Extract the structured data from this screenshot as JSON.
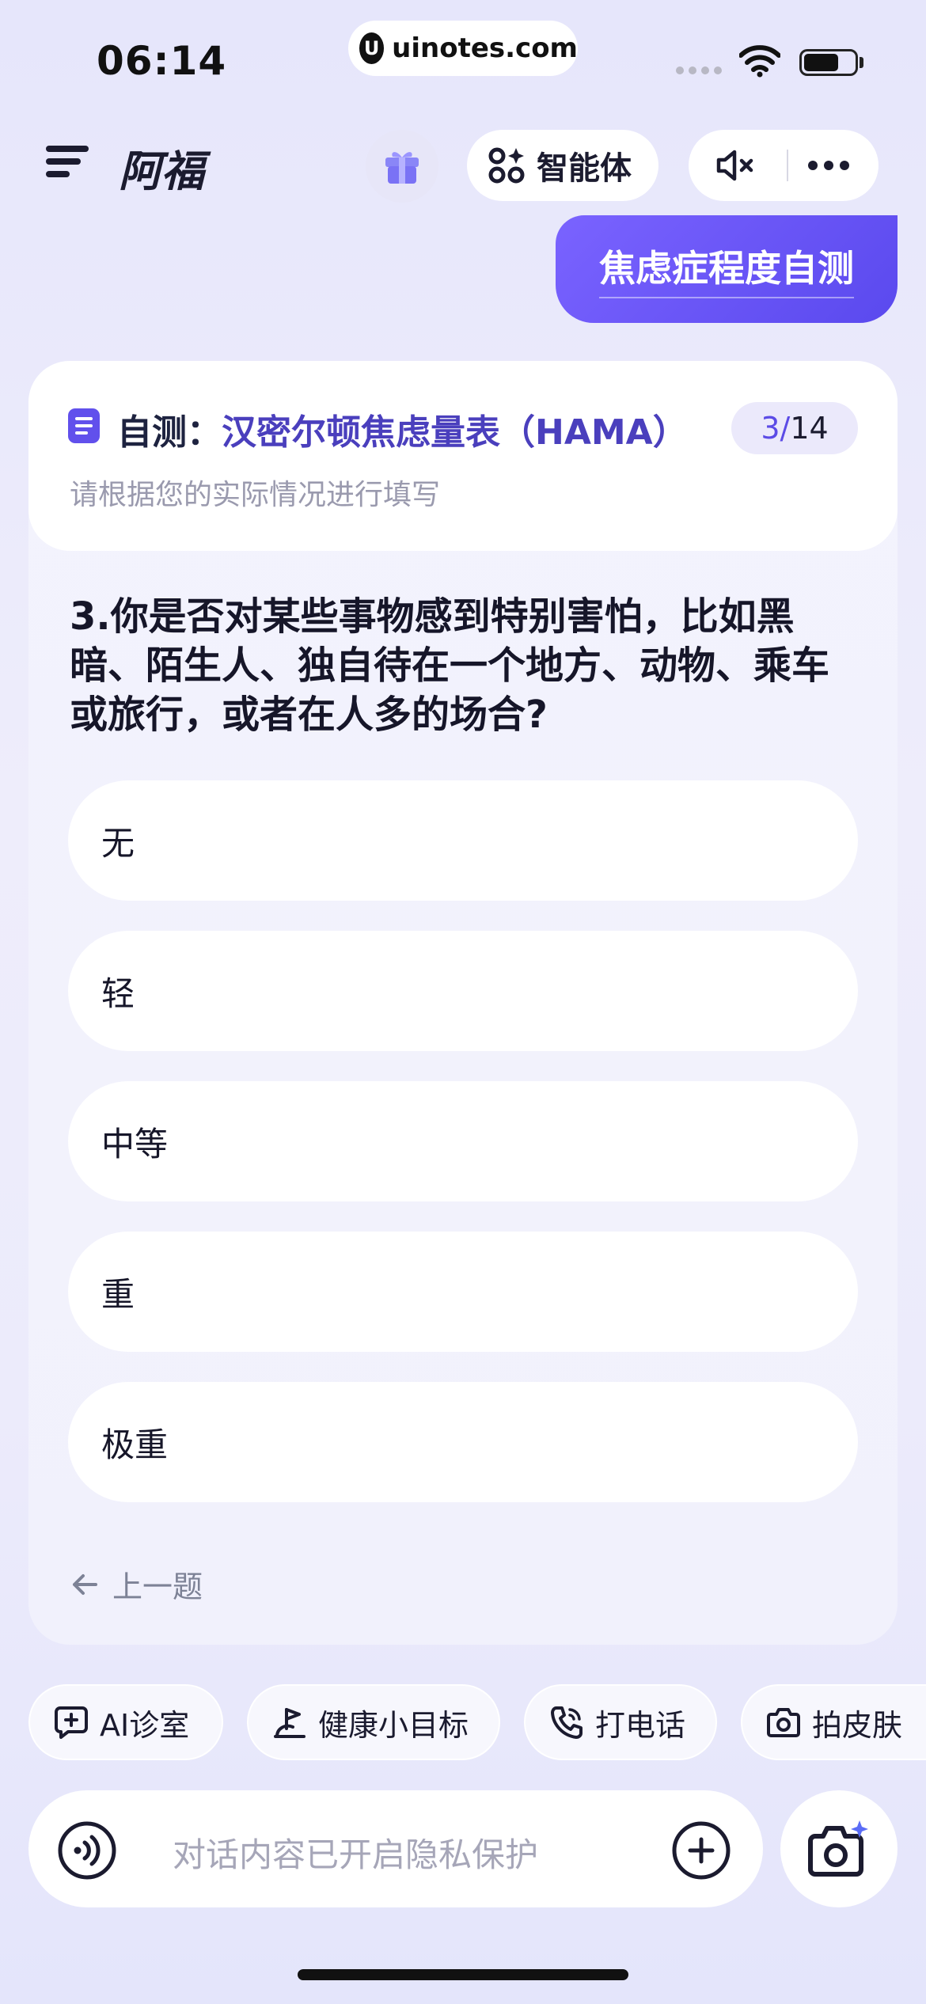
{
  "status": {
    "time": "06:14",
    "url": "uinotes.com",
    "url_logo": "U",
    "battery_level": 0.7
  },
  "header": {
    "title": "阿福",
    "agent_label": "智能体"
  },
  "chat": {
    "user_message": "焦虑症程度自测"
  },
  "card": {
    "title_prefix": "自测：",
    "title": "汉密尔顿焦虑量表（HAMA）",
    "progress_current": "3",
    "progress_sep": "/",
    "progress_total": "14",
    "subtitle": "请根据您的实际情况进行填写",
    "question": "3.你是否对某些事物感到特别害怕，比如黑暗、陌生人、独自待在一个地方、动物、乘车或旅行，或者在人多的场合?",
    "options": [
      "无",
      "轻",
      "中等",
      "重",
      "极重"
    ],
    "prev_label": "上一题"
  },
  "quick_actions": [
    "AI诊室",
    "健康小目标",
    "打电话",
    "拍皮肤"
  ],
  "input": {
    "placeholder": "对话内容已开启隐私保护"
  },
  "icons": [
    "menu-icon",
    "gift-icon",
    "agent-icon",
    "mute-icon",
    "more-icon",
    "doc-icon",
    "arrow-left-icon",
    "chat-icon",
    "target-icon",
    "phone-icon",
    "camera-icon",
    "voice-icon",
    "plus-icon",
    "camera-sparkle-icon"
  ],
  "colors": {
    "accent": "#5b4be6",
    "bubble": "#6a56f6",
    "card_bg": "#f2f2fc"
  }
}
